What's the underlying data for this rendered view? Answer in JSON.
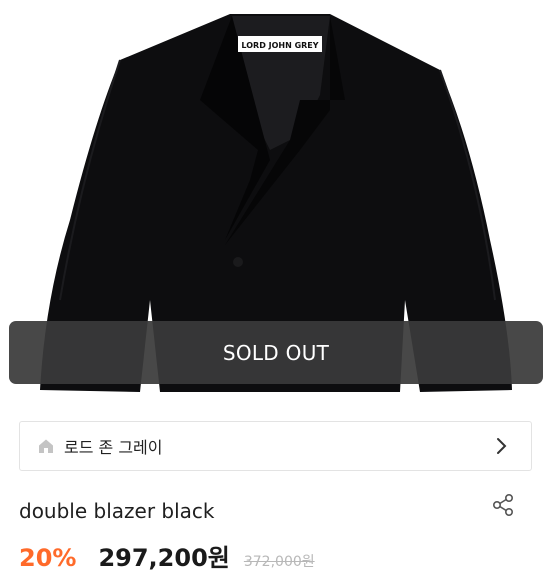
{
  "product": {
    "image_label_text": "LORD JOHN GREY",
    "sold_out_label": "SOLD OUT",
    "title": "double blazer black",
    "discount": "20%",
    "sale_price": "297,200원",
    "original_price": "372,000원"
  },
  "brand": {
    "name": "로드 존 그레이"
  },
  "icons": {
    "brand_home": "home-icon",
    "brand_link": "chevron-right-icon",
    "share": "share-icon"
  },
  "colors": {
    "sold_out_overlay": "#3a3a3a",
    "discount": "#ff6a2a",
    "garment": "#0d0d0f"
  }
}
